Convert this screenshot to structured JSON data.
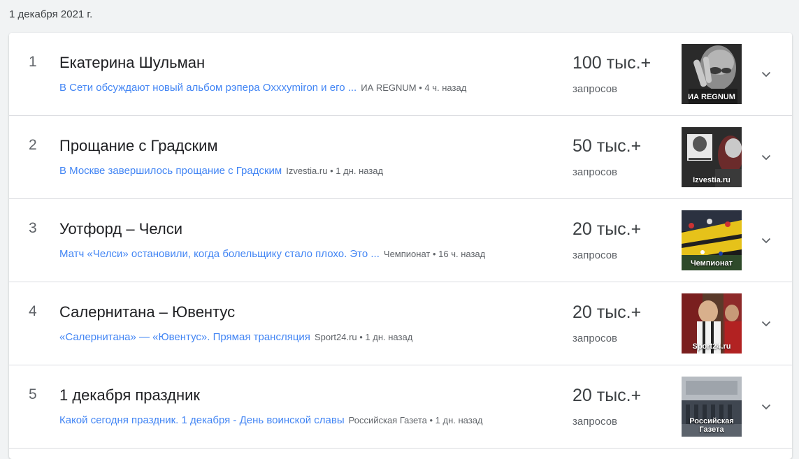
{
  "date": "1 декабря 2021 г.",
  "trends": [
    {
      "rank": "1",
      "title": "Екатерина Шульман",
      "news": "В Сети обсуждают новый альбом рэпера Oxxxymiron и его ...",
      "source": "ИА REGNUM • 4 ч. назад",
      "count": "100 тыс.+",
      "count_label": "запросов",
      "image_caption": "ИА REGNUM"
    },
    {
      "rank": "2",
      "title": "Прощание с Градским",
      "news": "В Москве завершилось прощание с Градским",
      "source": "Izvestia.ru • 1 дн. назад",
      "count": "50 тыс.+",
      "count_label": "запросов",
      "image_caption": "Izvestia.ru"
    },
    {
      "rank": "3",
      "title": "Уотфорд – Челси",
      "news": "Матч «Челси» остановили, когда болельщику стало плохо. Это ...",
      "source": "Чемпионат • 16 ч. назад",
      "count": "20 тыс.+",
      "count_label": "запросов",
      "image_caption": "Чемпионат"
    },
    {
      "rank": "4",
      "title": "Салернитана – Ювентус",
      "news": "«Салернитана» — «Ювентус». Прямая трансляция",
      "source": "Sport24.ru • 1 дн. назад",
      "count": "20 тыс.+",
      "count_label": "запросов",
      "image_caption": "Sport24.ru"
    },
    {
      "rank": "5",
      "title": "1 декабря праздник",
      "news": "Какой сегодня праздник. 1 декабря - День воинской славы",
      "source": "Российская Газета • 1 дн. назад",
      "count": "20 тыс.+",
      "count_label": "запросов",
      "image_caption": "Российская Газета"
    }
  ],
  "icons": {
    "expand": "chevron-down-icon"
  },
  "colors": {
    "link": "#4285f4",
    "muted": "#5f6368",
    "divider": "#dadce0"
  }
}
